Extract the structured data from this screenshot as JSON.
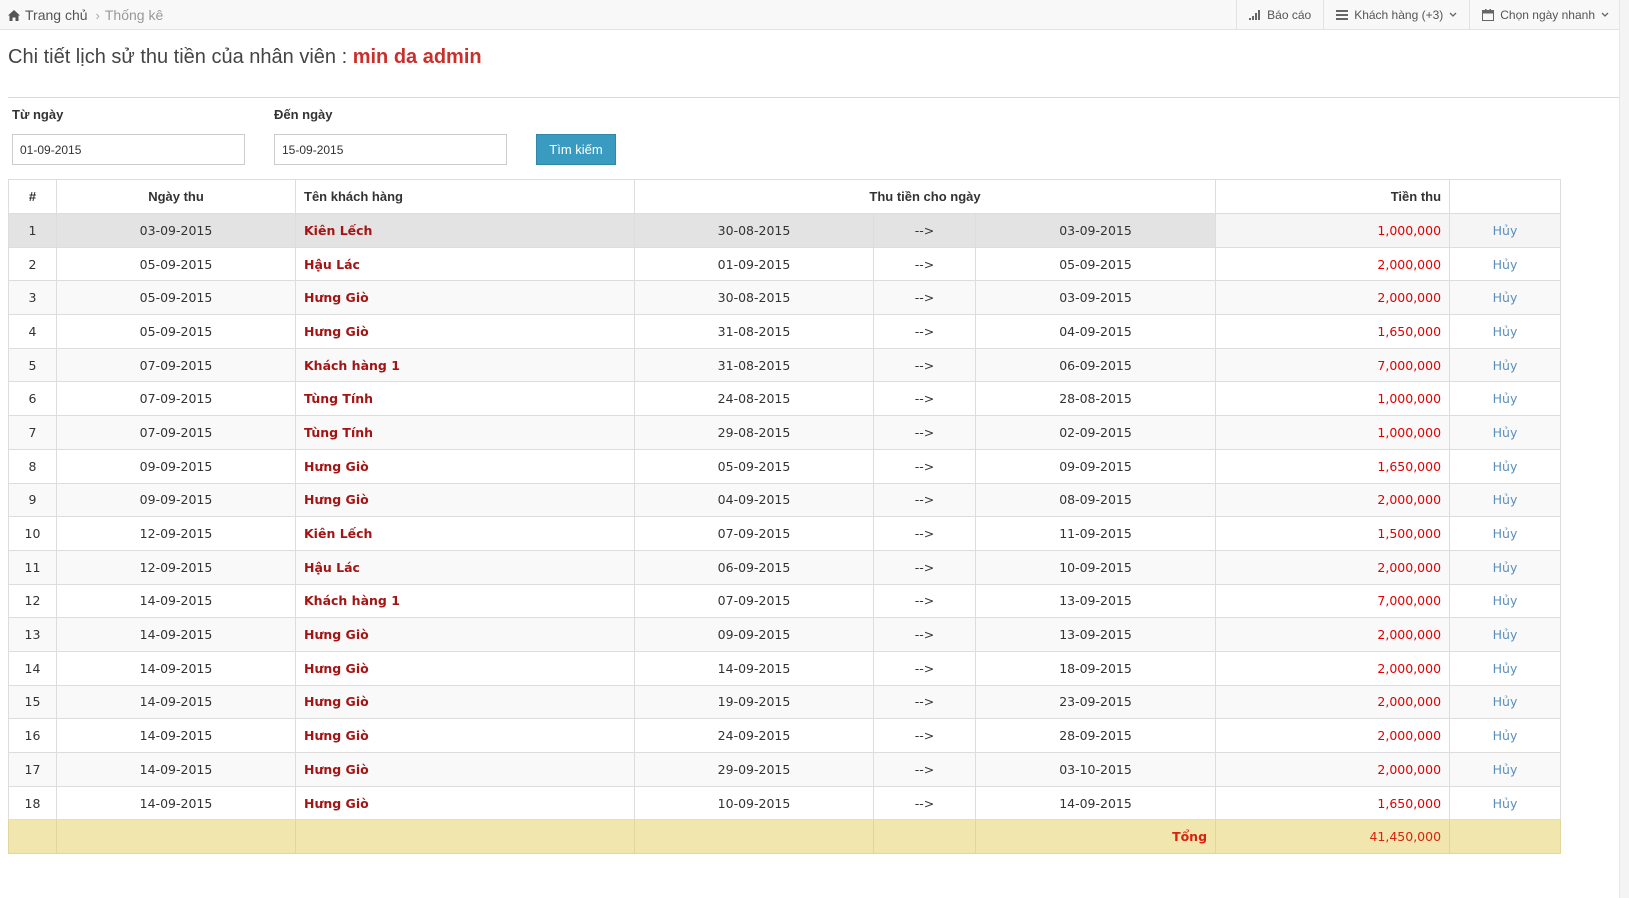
{
  "breadcrumb": {
    "home": "Trang chủ",
    "current": "Thống kê"
  },
  "top_menu": {
    "report": "Báo cáo",
    "customers": "Khách hàng (+3)",
    "quick_date": "Chọn ngày nhanh"
  },
  "title": {
    "prefix": "Chi tiết lịch sử thu tiền của nhân viên :",
    "employee": "min da admin"
  },
  "filters": {
    "from_label": "Từ ngày",
    "from_value": "01-09-2015",
    "to_label": "Đến ngày",
    "to_value": "15-09-2015",
    "search_label": "Tìm kiếm"
  },
  "table": {
    "headers": {
      "index": "#",
      "date": "Ngày thu",
      "customer": "Tên khách hàng",
      "period": "Thu tiền cho ngày",
      "amount": "Tiền thu"
    },
    "rows": [
      {
        "no": "1",
        "date": "03-09-2015",
        "customer": "Kiên Lếch",
        "from": "30-08-2015",
        "arrow": "-->",
        "to": "03-09-2015",
        "amount": "1,000,000",
        "action": "Hủy"
      },
      {
        "no": "2",
        "date": "05-09-2015",
        "customer": "Hậu Lác",
        "from": "01-09-2015",
        "arrow": "-->",
        "to": "05-09-2015",
        "amount": "2,000,000",
        "action": "Hủy"
      },
      {
        "no": "3",
        "date": "05-09-2015",
        "customer": "Hưng Giò",
        "from": "30-08-2015",
        "arrow": "-->",
        "to": "03-09-2015",
        "amount": "2,000,000",
        "action": "Hủy"
      },
      {
        "no": "4",
        "date": "05-09-2015",
        "customer": "Hưng Giò",
        "from": "31-08-2015",
        "arrow": "-->",
        "to": "04-09-2015",
        "amount": "1,650,000",
        "action": "Hủy"
      },
      {
        "no": "5",
        "date": "07-09-2015",
        "customer": "Khách hàng 1",
        "from": "31-08-2015",
        "arrow": "-->",
        "to": "06-09-2015",
        "amount": "7,000,000",
        "action": "Hủy"
      },
      {
        "no": "6",
        "date": "07-09-2015",
        "customer": "Tùng Tính",
        "from": "24-08-2015",
        "arrow": "-->",
        "to": "28-08-2015",
        "amount": "1,000,000",
        "action": "Hủy"
      },
      {
        "no": "7",
        "date": "07-09-2015",
        "customer": "Tùng Tính",
        "from": "29-08-2015",
        "arrow": "-->",
        "to": "02-09-2015",
        "amount": "1,000,000",
        "action": "Hủy"
      },
      {
        "no": "8",
        "date": "09-09-2015",
        "customer": "Hưng Giò",
        "from": "05-09-2015",
        "arrow": "-->",
        "to": "09-09-2015",
        "amount": "1,650,000",
        "action": "Hủy"
      },
      {
        "no": "9",
        "date": "09-09-2015",
        "customer": "Hưng Giò",
        "from": "04-09-2015",
        "arrow": "-->",
        "to": "08-09-2015",
        "amount": "2,000,000",
        "action": "Hủy"
      },
      {
        "no": "10",
        "date": "12-09-2015",
        "customer": "Kiên Lếch",
        "from": "07-09-2015",
        "arrow": "-->",
        "to": "11-09-2015",
        "amount": "1,500,000",
        "action": "Hủy"
      },
      {
        "no": "11",
        "date": "12-09-2015",
        "customer": "Hậu Lác",
        "from": "06-09-2015",
        "arrow": "-->",
        "to": "10-09-2015",
        "amount": "2,000,000",
        "action": "Hủy"
      },
      {
        "no": "12",
        "date": "14-09-2015",
        "customer": "Khách hàng 1",
        "from": "07-09-2015",
        "arrow": "-->",
        "to": "13-09-2015",
        "amount": "7,000,000",
        "action": "Hủy"
      },
      {
        "no": "13",
        "date": "14-09-2015",
        "customer": "Hưng Giò",
        "from": "09-09-2015",
        "arrow": "-->",
        "to": "13-09-2015",
        "amount": "2,000,000",
        "action": "Hủy"
      },
      {
        "no": "14",
        "date": "14-09-2015",
        "customer": "Hưng Giò",
        "from": "14-09-2015",
        "arrow": "-->",
        "to": "18-09-2015",
        "amount": "2,000,000",
        "action": "Hủy"
      },
      {
        "no": "15",
        "date": "14-09-2015",
        "customer": "Hưng Giò",
        "from": "19-09-2015",
        "arrow": "-->",
        "to": "23-09-2015",
        "amount": "2,000,000",
        "action": "Hủy"
      },
      {
        "no": "16",
        "date": "14-09-2015",
        "customer": "Hưng Giò",
        "from": "24-09-2015",
        "arrow": "-->",
        "to": "28-09-2015",
        "amount": "2,000,000",
        "action": "Hủy"
      },
      {
        "no": "17",
        "date": "14-09-2015",
        "customer": "Hưng Giò",
        "from": "29-09-2015",
        "arrow": "-->",
        "to": "03-10-2015",
        "amount": "2,000,000",
        "action": "Hủy"
      },
      {
        "no": "18",
        "date": "14-09-2015",
        "customer": "Hưng Giò",
        "from": "10-09-2015",
        "arrow": "-->",
        "to": "14-09-2015",
        "amount": "1,650,000",
        "action": "Hủy"
      }
    ],
    "total_label": "Tổng",
    "total_value": "41,450,000"
  },
  "colors": {
    "accent": "#c9302c",
    "amount": "#e00000",
    "button": "#3a9bc0",
    "total_row": "#f0e6ae",
    "link": "#5a8fbd"
  },
  "icons": {
    "home": "home-icon",
    "report": "bar-chart-icon",
    "customers": "list-icon",
    "quick_date": "calendar-icon",
    "chevron": "chevron-down-icon",
    "separator": "chevron-right-icon"
  }
}
